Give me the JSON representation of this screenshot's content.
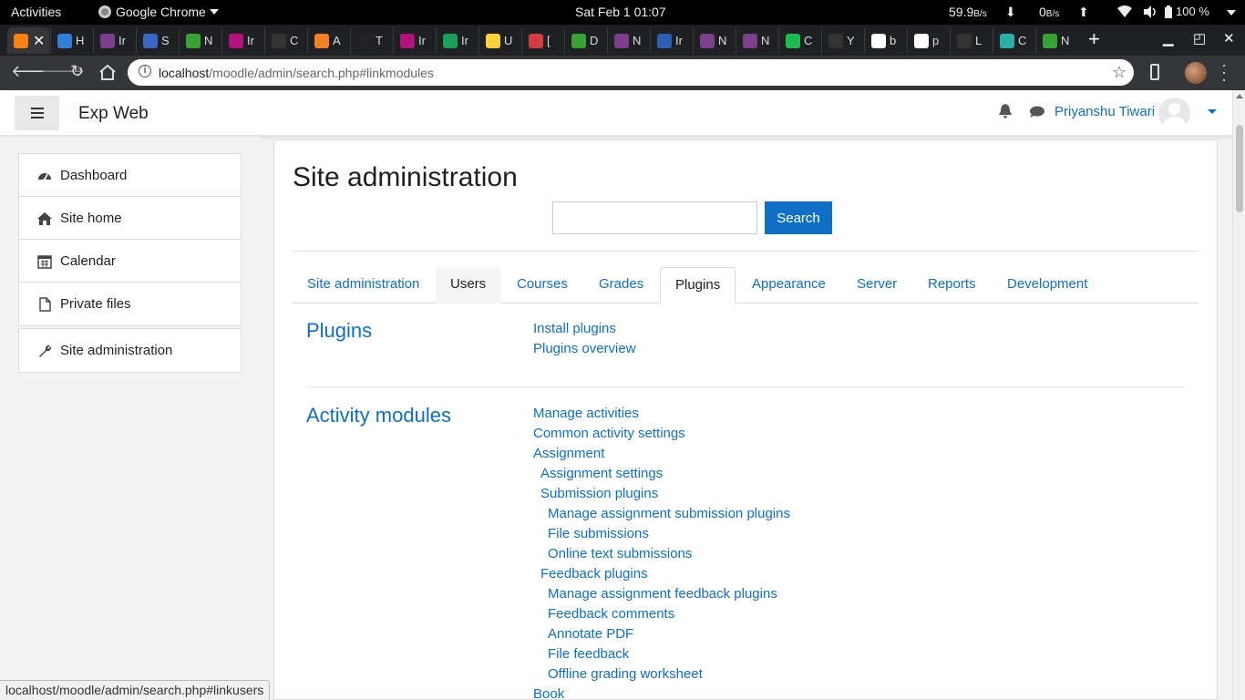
{
  "os_bar": {
    "activities": "Activities",
    "app_name": "Google Chrome",
    "clock": "Sat Feb 1  01:07",
    "net_down_value": "59.9",
    "net_down_unit": "B/s",
    "net_up_value": "0",
    "net_up_unit": "B/s",
    "battery": "100 %"
  },
  "tabs": [
    {
      "icon": "moodle",
      "color": "#f98012",
      "active": true
    },
    {
      "icon": "H",
      "color": "#2f7fd8",
      "text": "H"
    },
    {
      "icon": "In",
      "color": "#7b3f8c",
      "text": "Ir"
    },
    {
      "icon": "S",
      "color": "#3c66c4",
      "text": "S"
    },
    {
      "icon": "M",
      "color": "#3aa335",
      "text": "N"
    },
    {
      "icon": "In",
      "color": "#b3127c",
      "text": "Ir"
    },
    {
      "icon": "C",
      "color": "#333333",
      "text": "C"
    },
    {
      "icon": "A",
      "color": "#f48024",
      "text": "A"
    },
    {
      "icon": "T",
      "color": "#222222",
      "text": "T"
    },
    {
      "icon": "In",
      "color": "#b3127c",
      "text": "Ir"
    },
    {
      "icon": "In",
      "color": "#1a9e5a",
      "text": "Ir"
    },
    {
      "icon": "U",
      "color": "#f7d33b",
      "text": "U"
    },
    {
      "icon": "[",
      "color": "#d23d3d",
      "text": "["
    },
    {
      "icon": "D",
      "color": "#3aa335",
      "text": "D"
    },
    {
      "icon": "N",
      "color": "#7b3f8c",
      "text": "N"
    },
    {
      "icon": "In",
      "color": "#2b5fb3",
      "text": "Ir"
    },
    {
      "icon": "N",
      "color": "#7b3f8c",
      "text": "N"
    },
    {
      "icon": "N",
      "color": "#7b3f8c",
      "text": "N"
    },
    {
      "icon": "C",
      "color": "#1db954",
      "text": "C"
    },
    {
      "icon": "Y",
      "color": "#333333",
      "text": "Y"
    },
    {
      "icon": "b",
      "color": "#ffffff",
      "text": "b"
    },
    {
      "icon": "p",
      "color": "#ffffff",
      "text": "p"
    },
    {
      "icon": "L",
      "color": "#333333",
      "text": "L"
    },
    {
      "icon": "C",
      "color": "#2ab0a8",
      "text": "C"
    },
    {
      "icon": "N",
      "color": "#3aa335",
      "text": "N"
    }
  ],
  "omnibox": {
    "url_host": "localhost",
    "url_path": "/moodle/admin/search.php#linkmodules"
  },
  "header": {
    "site_name": "Exp Web",
    "user_name": "Priyanshu Tiwari"
  },
  "drawer": {
    "main_items": [
      {
        "label": "Dashboard",
        "icon": "dashboard-icon"
      },
      {
        "label": "Site home",
        "icon": "home-icon"
      },
      {
        "label": "Calendar",
        "icon": "calendar-icon"
      },
      {
        "label": "Private files",
        "icon": "file-icon"
      }
    ],
    "admin_item": {
      "label": "Site administration",
      "icon": "wrench-icon"
    }
  },
  "main": {
    "title": "Site administration",
    "search_button": "Search",
    "search_value": "",
    "tabs": [
      {
        "label": "Site administration",
        "state": "normal"
      },
      {
        "label": "Users",
        "state": "hovered"
      },
      {
        "label": "Courses",
        "state": "normal"
      },
      {
        "label": "Grades",
        "state": "normal"
      },
      {
        "label": "Plugins",
        "state": "active"
      },
      {
        "label": "Appearance",
        "state": "normal"
      },
      {
        "label": "Server",
        "state": "normal"
      },
      {
        "label": "Reports",
        "state": "normal"
      },
      {
        "label": "Development",
        "state": "normal"
      }
    ],
    "sections": [
      {
        "heading": "Plugins",
        "links": [
          {
            "label": "Install plugins",
            "indent": 0
          },
          {
            "label": "Plugins overview",
            "indent": 0
          }
        ]
      },
      {
        "heading": "Activity modules",
        "links": [
          {
            "label": "Manage activities",
            "indent": 0
          },
          {
            "label": "Common activity settings",
            "indent": 0
          },
          {
            "label": "Assignment",
            "indent": 0
          },
          {
            "label": "Assignment settings",
            "indent": 1
          },
          {
            "label": "Submission plugins",
            "indent": 1
          },
          {
            "label": "Manage assignment submission plugins",
            "indent": 2
          },
          {
            "label": "File submissions",
            "indent": 2
          },
          {
            "label": "Online text submissions",
            "indent": 2
          },
          {
            "label": "Feedback plugins",
            "indent": 1
          },
          {
            "label": "Manage assignment feedback plugins",
            "indent": 2
          },
          {
            "label": "Feedback comments",
            "indent": 2
          },
          {
            "label": "Annotate PDF",
            "indent": 2
          },
          {
            "label": "File feedback",
            "indent": 2
          },
          {
            "label": "Offline grading worksheet",
            "indent": 2
          },
          {
            "label": "Book",
            "indent": 0
          }
        ]
      }
    ]
  },
  "status_url": "localhost/moodle/admin/search.php#linkusers"
}
